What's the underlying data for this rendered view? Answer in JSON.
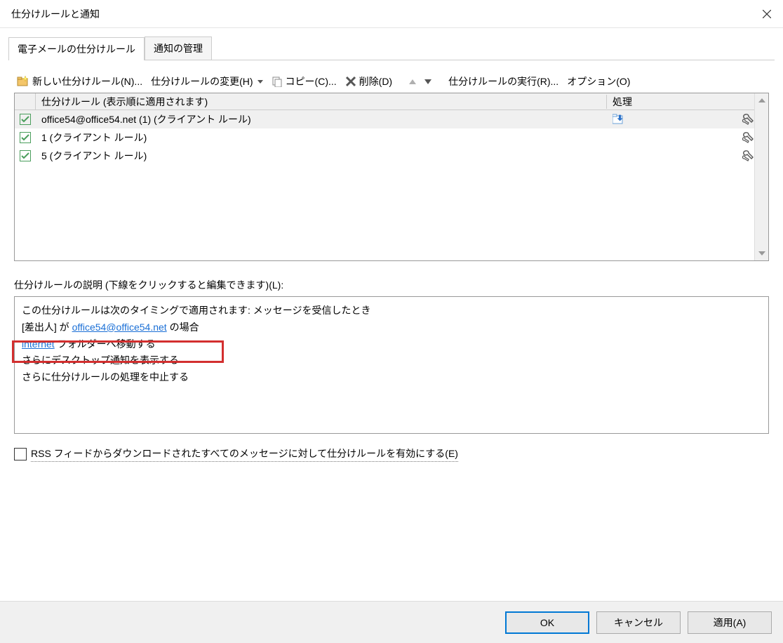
{
  "titlebar": {
    "title": "仕分けルールと通知"
  },
  "tabs": {
    "email_rules": "電子メールの仕分けルール",
    "manage_alerts": "通知の管理"
  },
  "toolbar": {
    "new_rule": "新しい仕分けルール(N)...",
    "change_rule": "仕分けルールの変更(H)",
    "copy": "コピー(C)...",
    "delete": "削除(D)",
    "run_rules": "仕分けルールの実行(R)...",
    "options": "オプション(O)"
  },
  "grid": {
    "header_rule": "仕分けルール (表示順に適用されます)",
    "header_action": "処理",
    "rows": [
      {
        "name": "office54@office54.net (1)  (クライアント ルール)",
        "selected": true,
        "show_move": true
      },
      {
        "name": "1  (クライアント ルール)",
        "selected": false,
        "show_move": false
      },
      {
        "name": "5  (クライアント ルール)",
        "selected": false,
        "show_move": false
      }
    ]
  },
  "desc": {
    "label": "仕分けルールの説明 (下線をクリックすると編集できます)(L):",
    "line1": "この仕分けルールは次のタイミングで適用されます: メッセージを受信したとき",
    "sender_prefix": "[差出人] が ",
    "sender_link": "office54@office54.net",
    "sender_suffix": " の場合",
    "folder_link": "internet",
    "folder_suffix": " フォルダーへ移動する",
    "desktop_alert": "さらにデスクトップ通知を表示する",
    "stop": "さらに仕分けルールの処理を中止する"
  },
  "rss": {
    "label": "RSS フィードからダウンロードされたすべてのメッセージに対して仕分けルールを有効にする(E)"
  },
  "footer": {
    "ok": "OK",
    "cancel": "キャンセル",
    "apply": "適用(A)"
  }
}
